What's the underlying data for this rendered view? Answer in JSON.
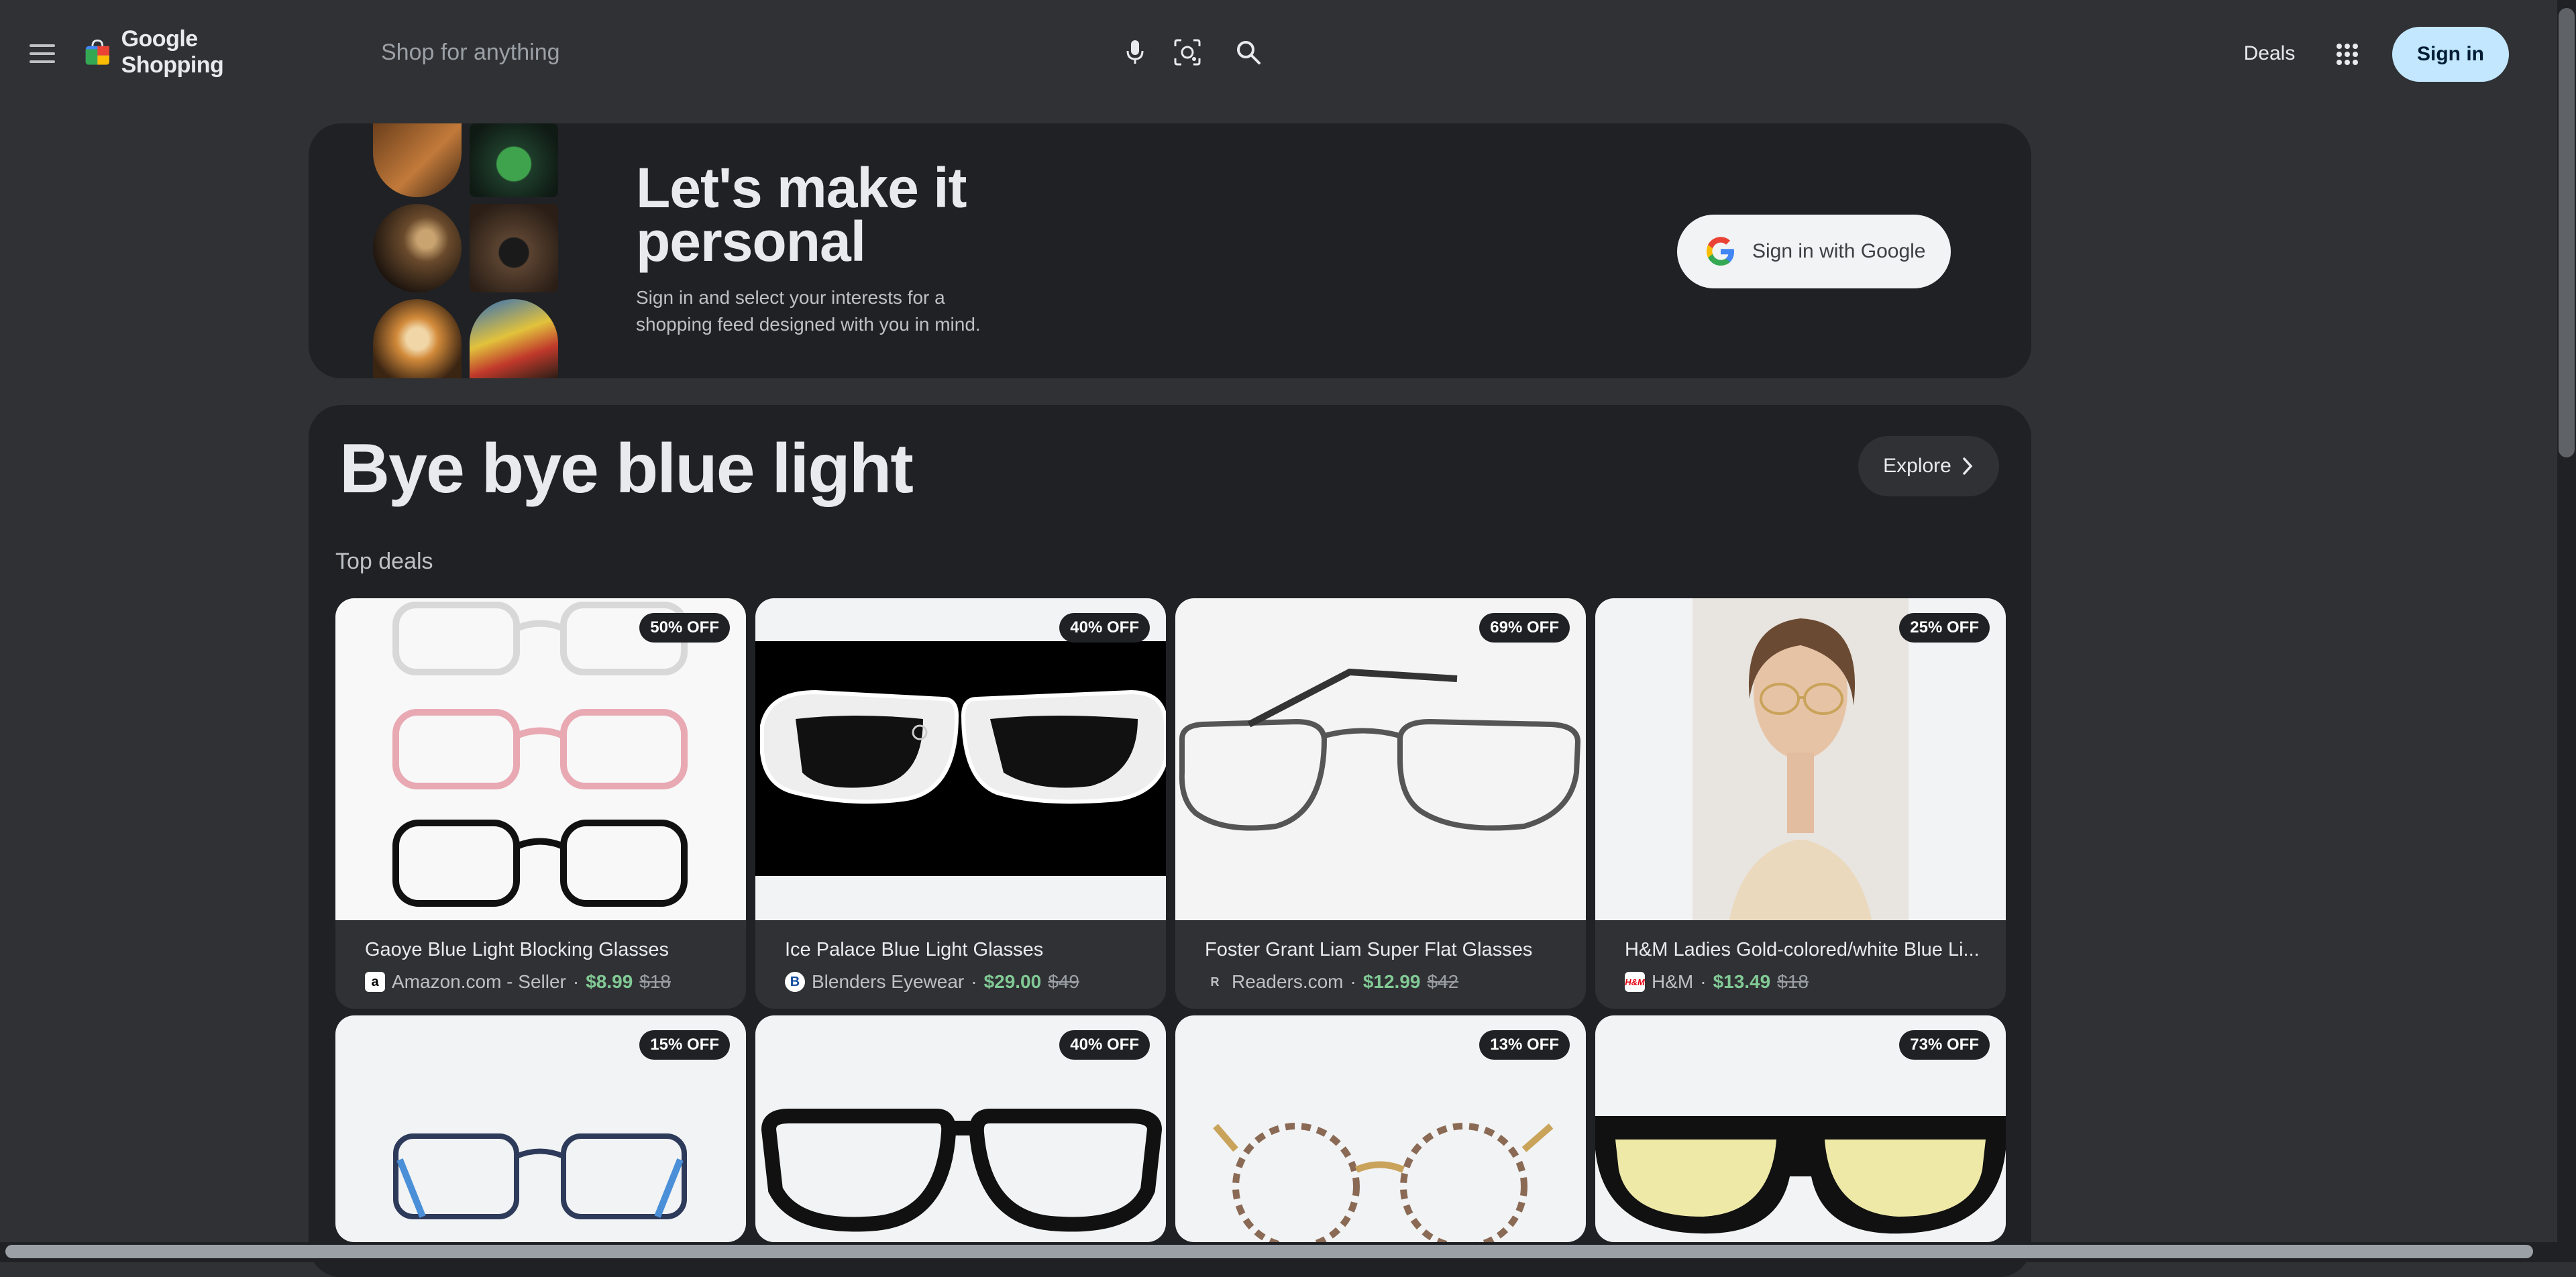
{
  "header": {
    "menu_icon": "hamburger-menu-icon",
    "logo_text": "Google Shopping",
    "search_placeholder": "Shop for anything",
    "mic_icon": "microphone-icon",
    "lens_icon": "camera-search-icon",
    "search_icon": "search-icon",
    "deals_label": "Deals",
    "apps_icon": "apps-grid-icon",
    "signin_label": "Sign in"
  },
  "banner": {
    "title": "Let's make it personal",
    "subtitle": "Sign in and select your interests for a shopping feed designed with you in mind.",
    "google_signin_label": "Sign in with Google"
  },
  "module": {
    "title": "Bye bye blue light",
    "explore_label": "Explore",
    "section_label": "Top deals"
  },
  "products": [
    {
      "badge": "50% OFF",
      "title": "Gaoye Blue Light Blocking Glasses",
      "seller": "Amazon.com - Seller",
      "seller_icon": "a",
      "price": "$8.99",
      "old_price": "$18"
    },
    {
      "badge": "40% OFF",
      "title": "Ice Palace Blue Light Glasses",
      "seller": "Blenders Eyewear",
      "seller_icon": "B",
      "price": "$29.00",
      "old_price": "$49"
    },
    {
      "badge": "69% OFF",
      "title": "Foster Grant Liam Super Flat Glasses",
      "seller": "Readers.com",
      "seller_icon": "R",
      "price": "$12.99",
      "old_price": "$42"
    },
    {
      "badge": "25% OFF",
      "title": "H&M Ladies Gold-colored/white Blue Li...",
      "seller": "H&M",
      "seller_icon": "H&M",
      "price": "$13.49",
      "old_price": "$18"
    },
    {
      "badge": "15% OFF"
    },
    {
      "badge": "40% OFF"
    },
    {
      "badge": "13% OFF"
    },
    {
      "badge": "73% OFF"
    }
  ],
  "colors": {
    "background": "#303134",
    "card": "#303134",
    "module": "#202124",
    "price_green": "#81c995",
    "signin_blue": "#c2e7ff"
  }
}
